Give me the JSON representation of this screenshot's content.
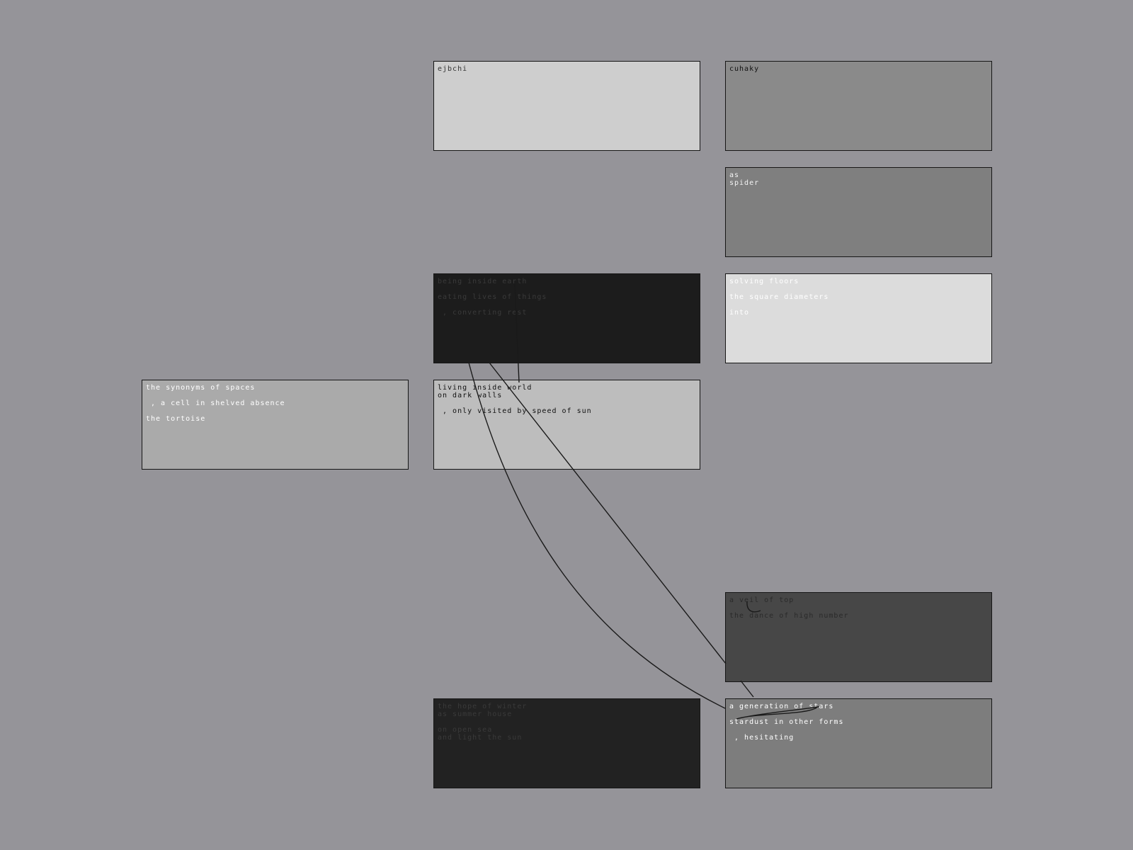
{
  "cards": [
    {
      "id": "c1",
      "bg": "#cecece",
      "fg": "#333333",
      "lines": [
        "ejbchi"
      ]
    },
    {
      "id": "c2",
      "bg": "#8a8a8a",
      "fg": "#111111",
      "lines": [
        "cuhaky"
      ]
    },
    {
      "id": "c3",
      "bg": "#7f7f7f",
      "fg": "#f4f4f4",
      "lines": [
        "as",
        "spider"
      ]
    },
    {
      "id": "c4",
      "bg": "#1c1c1c",
      "fg": "#3a3a3a",
      "lines": [
        "being inside earth",
        "",
        "eating lives of things",
        "",
        " , converting rest"
      ]
    },
    {
      "id": "c5",
      "bg": "#dcdcdc",
      "fg": "#ffffff",
      "lines": [
        "solving floors",
        "",
        "the square diameters",
        "",
        "into"
      ]
    },
    {
      "id": "c6",
      "bg": "#aaaaaa",
      "fg": "#ffffff",
      "lines": [
        "the synonyms of spaces",
        "",
        " , a cell in shelved absence",
        "",
        "the tortoise"
      ]
    },
    {
      "id": "c7",
      "bg": "#bdbdbd",
      "fg": "#111111",
      "lines": [
        "living inside world",
        "on dark walls",
        "",
        " , only visited by speed of sun"
      ]
    },
    {
      "id": "c8",
      "bg": "#474747",
      "fg": "#2a2a2a",
      "lines": [
        "a veil of top",
        "",
        "the dance of high number"
      ]
    },
    {
      "id": "c9",
      "bg": "#222222",
      "fg": "#3a3a3a",
      "lines": [
        "the hope of winter",
        "as summer house",
        "",
        "on open sea",
        "and light the sun"
      ]
    },
    {
      "id": "c10",
      "bg": "#7d7d7d",
      "fg": "#ffffff",
      "lines": [
        "a generation of stars",
        "",
        "stardust in other forms",
        "",
        " , hesitating"
      ]
    }
  ],
  "colors": {
    "background": "#959499",
    "border": "#161616",
    "connector": "#1a1a1a"
  }
}
